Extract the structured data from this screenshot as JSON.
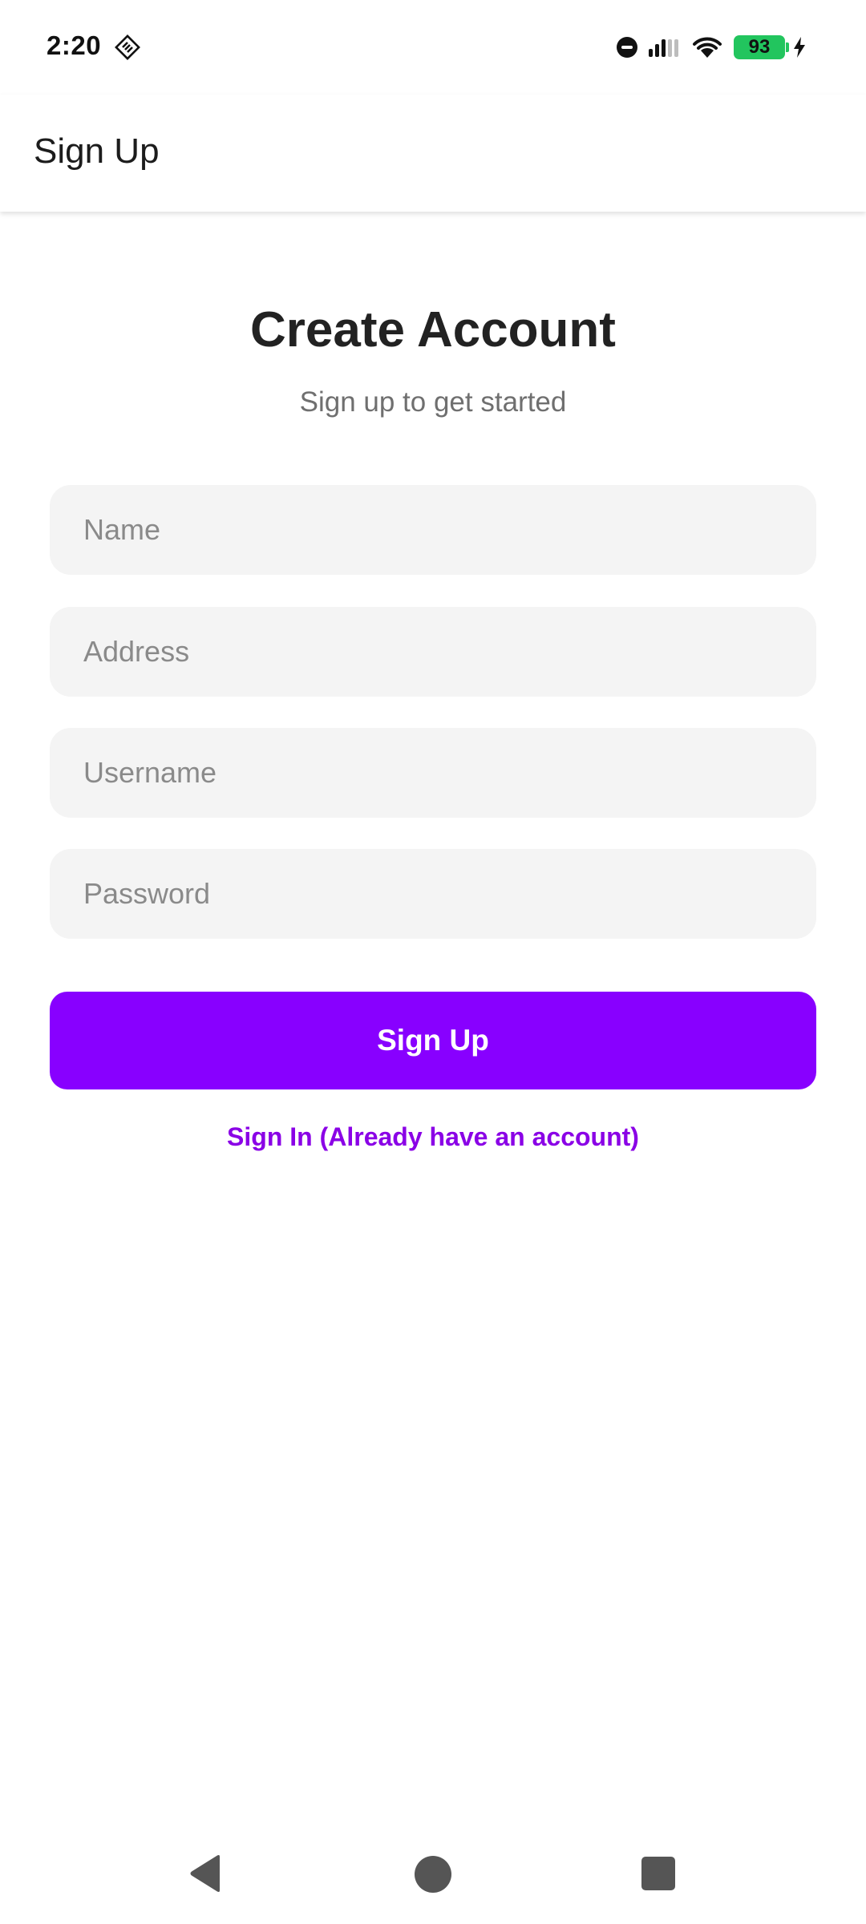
{
  "status_bar": {
    "time": "2:20",
    "battery_level": "93",
    "icons": [
      "ruler-diamond-icon",
      "do-not-disturb-icon",
      "signal-icon",
      "wifi-icon",
      "battery-icon",
      "charging-bolt-icon"
    ]
  },
  "app_bar": {
    "title": "Sign Up"
  },
  "form": {
    "heading": "Create Account",
    "subheading": "Sign up to get started",
    "name_placeholder": "Name",
    "address_placeholder": "Address",
    "username_placeholder": "Username",
    "password_placeholder": "Password",
    "submit_label": "Sign Up",
    "signin_link": "Sign In (Already have an account)"
  },
  "nav_bar": {
    "icons": [
      "back-icon",
      "home-icon",
      "recents-icon"
    ]
  },
  "colors": {
    "accent": "#8800ff",
    "link": "#8a00e6",
    "field_bg": "#f4f4f4",
    "battery": "#22c55e"
  }
}
